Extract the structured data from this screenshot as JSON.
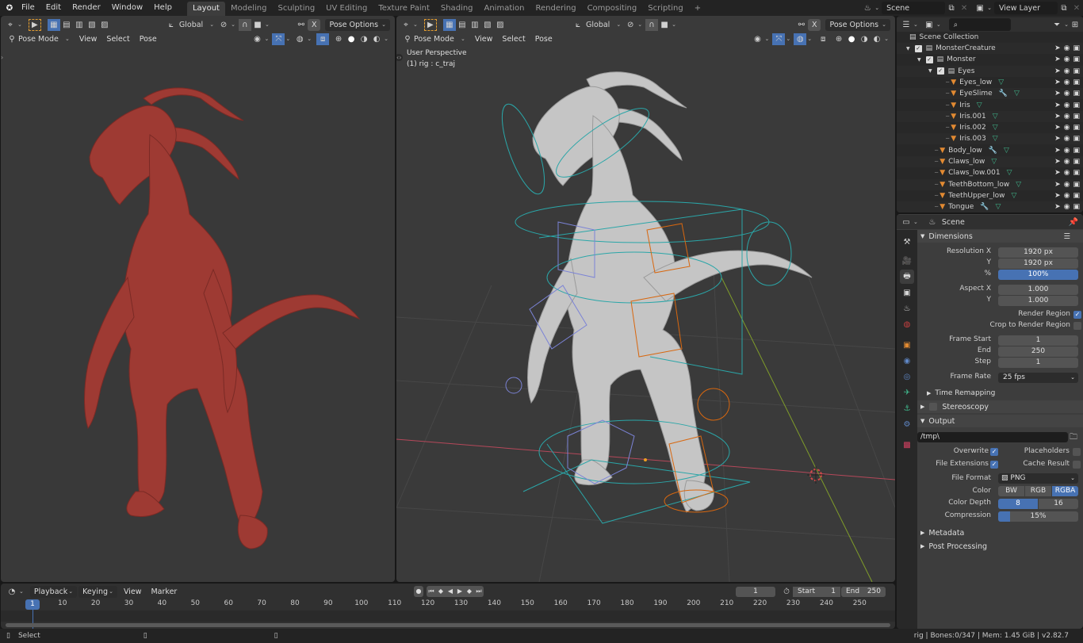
{
  "topbar": {
    "menus": [
      "File",
      "Edit",
      "Render",
      "Window",
      "Help"
    ],
    "workspaces": [
      "Layout",
      "Modeling",
      "Sculpting",
      "UV Editing",
      "Texture Paint",
      "Shading",
      "Animation",
      "Rendering",
      "Compositing",
      "Scripting"
    ],
    "active_workspace": "Layout",
    "add_workspace": "+",
    "scene": "Scene",
    "view_layer": "View Layer"
  },
  "viewport_left": {
    "transform_orientation": "Global",
    "pose_options": "Pose Options",
    "mode": "Pose Mode",
    "menus": [
      "View",
      "Select",
      "Pose"
    ],
    "x_mirror": "X"
  },
  "viewport_right": {
    "transform_orientation": "Global",
    "pose_options": "Pose Options",
    "mode": "Pose Mode",
    "menus": [
      "View",
      "Select",
      "Pose"
    ],
    "x_mirror": "X",
    "overlay_line1": "User Perspective",
    "overlay_line2": "(1) rig : c_traj"
  },
  "outliner": {
    "search_placeholder": "",
    "root": "Scene Collection",
    "rows": [
      {
        "label": "MonsterCreature",
        "type": "collection",
        "depth": 1,
        "checked": true
      },
      {
        "label": "Monster",
        "type": "collection",
        "depth": 2,
        "checked": true
      },
      {
        "label": "Eyes",
        "type": "collection",
        "depth": 3,
        "checked": true
      },
      {
        "label": "Eyes_low",
        "type": "object",
        "depth": 4,
        "modifier": false
      },
      {
        "label": "EyeSlime",
        "type": "object",
        "depth": 4,
        "modifier": true
      },
      {
        "label": "Iris",
        "type": "object",
        "depth": 4,
        "modifier": false
      },
      {
        "label": "Iris.001",
        "type": "object",
        "depth": 4,
        "modifier": false
      },
      {
        "label": "Iris.002",
        "type": "object",
        "depth": 4,
        "modifier": false
      },
      {
        "label": "Iris.003",
        "type": "object",
        "depth": 4,
        "modifier": false
      },
      {
        "label": "Body_low",
        "type": "object",
        "depth": 3,
        "modifier": true
      },
      {
        "label": "Claws_low",
        "type": "object",
        "depth": 3,
        "modifier": false
      },
      {
        "label": "Claws_low.001",
        "type": "object",
        "depth": 3,
        "modifier": false
      },
      {
        "label": "TeethBottom_low",
        "type": "object",
        "depth": 3,
        "modifier": false
      },
      {
        "label": "TeethUpper_low",
        "type": "object",
        "depth": 3,
        "modifier": false
      },
      {
        "label": "Tongue",
        "type": "object",
        "depth": 3,
        "modifier": true
      }
    ]
  },
  "properties": {
    "context": "Scene",
    "dimensions": {
      "title": "Dimensions",
      "resolution_x_label": "Resolution X",
      "resolution_x": "1920 px",
      "resolution_y_label": "Y",
      "resolution_y": "1920 px",
      "percent_label": "%",
      "percent": "100%",
      "aspect_x_label": "Aspect X",
      "aspect_x": "1.000",
      "aspect_y_label": "Y",
      "aspect_y": "1.000",
      "render_region_label": "Render Region",
      "render_region": true,
      "crop_label": "Crop to Render Region",
      "crop": false,
      "frame_start_label": "Frame Start",
      "frame_start": "1",
      "end_label": "End",
      "end": "250",
      "step_label": "Step",
      "step": "1",
      "frame_rate_label": "Frame Rate",
      "frame_rate": "25 fps",
      "time_remapping": "Time Remapping"
    },
    "stereoscopy": "Stereoscopy",
    "output": {
      "title": "Output",
      "path": "/tmp\\",
      "overwrite_label": "Overwrite",
      "overwrite": true,
      "placeholders_label": "Placeholders",
      "placeholders": false,
      "file_extensions_label": "File Extensions",
      "file_extensions": true,
      "cache_result_label": "Cache Result",
      "cache_result": false,
      "file_format_label": "File Format",
      "file_format": "PNG",
      "color_label": "Color",
      "color_options": [
        "BW",
        "RGB",
        "RGBA"
      ],
      "color_selected": "RGBA",
      "color_depth_label": "Color Depth",
      "depth_options": [
        "8",
        "16"
      ],
      "depth_selected": "8",
      "compression_label": "Compression",
      "compression": "15%",
      "compression_fraction": 0.15
    },
    "metadata": "Metadata",
    "post_processing": "Post Processing"
  },
  "timeline": {
    "menus": [
      "Playback",
      "Keying",
      "View",
      "Marker"
    ],
    "current_frame": "1",
    "start_label": "Start",
    "start": "1",
    "end_label": "End",
    "end": "250",
    "ticks": [
      "10",
      "20",
      "30",
      "40",
      "50",
      "60",
      "70",
      "80",
      "90",
      "100",
      "110",
      "120",
      "130",
      "140",
      "150",
      "160",
      "170",
      "180",
      "190",
      "200",
      "210",
      "220",
      "230",
      "240",
      "250"
    ]
  },
  "statusbar": {
    "left": "Select",
    "right": "rig | Bones:0/347  | Mem: 1.45 GiB | v2.82.7"
  },
  "colors": {
    "accent": "#4772b3",
    "object_orange": "#e28a32",
    "mesh_green": "#3fb58a",
    "clay_red": "#9e3a33",
    "clay_gray": "#c7c7c7",
    "rig_cyan": "#2aa6a8",
    "rig_blue": "#7b83d6",
    "rig_orange": "#d8670f"
  }
}
